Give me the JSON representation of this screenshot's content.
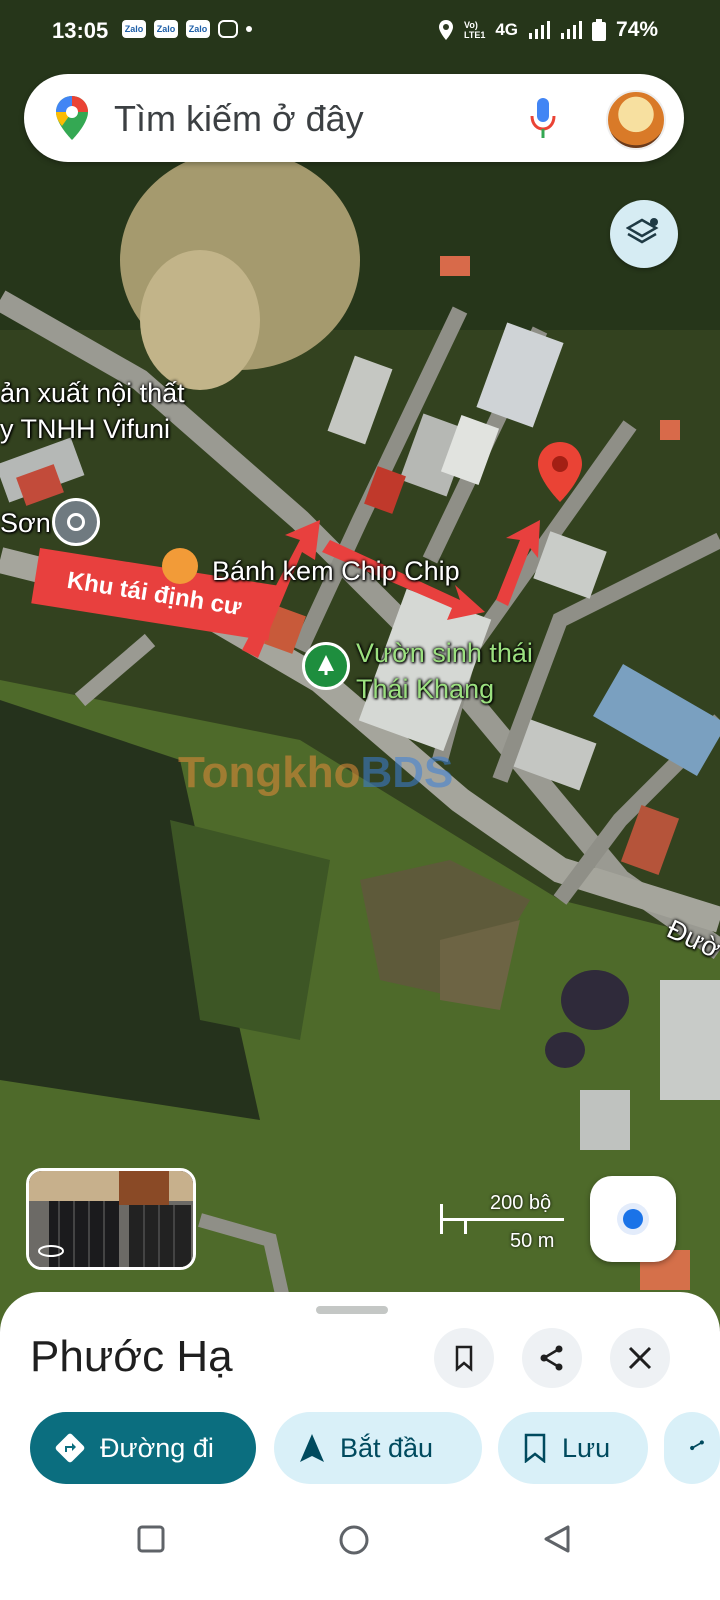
{
  "status_bar": {
    "time": "13:05",
    "apps": [
      "Zalo",
      "Zalo",
      "Zalo"
    ],
    "network": "4G",
    "battery": "74%"
  },
  "search": {
    "placeholder": "Tìm kiếm ở đây"
  },
  "map": {
    "labels": {
      "furniture_1": "ản xuất nội thất",
      "furniture_2": "y TNHH Vifuni",
      "son": "Sơn",
      "bakery": "Bánh kem Chip Chip",
      "eco_park_1": "Vườn sinh thái",
      "eco_park_2": "Thái Khang",
      "road": "Đườ"
    },
    "annotation": "Khu tái định cư",
    "watermark": {
      "part1": "Tongkho",
      "part2": "BDS"
    },
    "scale": {
      "feet": "200 bộ",
      "meters": "50 m"
    }
  },
  "place_sheet": {
    "title": "Phước Hạ",
    "actions": [
      {
        "label": "Đường đi",
        "icon": "directions-icon"
      },
      {
        "label": "Bắt đầu",
        "icon": "navigation-arrow-icon"
      },
      {
        "label": "Lưu",
        "icon": "bookmark-icon"
      }
    ]
  },
  "colors": {
    "primary_chip": "#0b6e7f",
    "secondary_chip": "#d9f0f8",
    "annotation_red": "#e8403e",
    "pin_red": "#ea4335"
  }
}
